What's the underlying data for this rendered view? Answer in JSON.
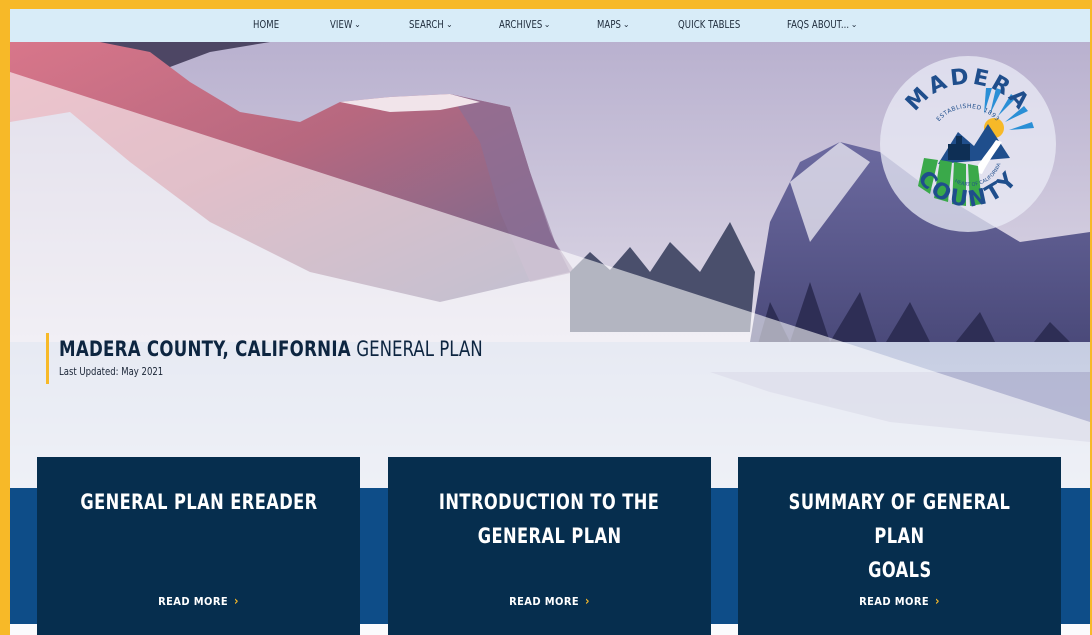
{
  "nav": {
    "items": [
      {
        "label": "HOME",
        "dropdown": false
      },
      {
        "label": "VIEW",
        "dropdown": true
      },
      {
        "label": "SEARCH",
        "dropdown": true
      },
      {
        "label": "ARCHIVES",
        "dropdown": true
      },
      {
        "label": "MAPS",
        "dropdown": true
      },
      {
        "label": "QUICK TABLES",
        "dropdown": false
      },
      {
        "label": "FAQS ABOUT...",
        "dropdown": true
      }
    ],
    "chevron": "⌄"
  },
  "seal": {
    "top_text": "MADERA",
    "bottom_text": "COUNTY",
    "established": "ESTABLISHED 1893",
    "motto": "HEART OF CALIFORNIA"
  },
  "hero": {
    "title_bold": "MADERA COUNTY, CALIFORNIA",
    "title_light": "GENERAL PLAN",
    "updated": "Last Updated: May 2021"
  },
  "cards": [
    {
      "title_lines": [
        "GENERAL PLAN EREADER"
      ],
      "link": "READ MORE",
      "arrow": "›"
    },
    {
      "title_lines": [
        "INTRODUCTION TO THE",
        "GENERAL PLAN"
      ],
      "link": "READ MORE",
      "arrow": "›"
    },
    {
      "title_lines": [
        "SUMMARY OF GENERAL PLAN",
        "GOALS"
      ],
      "link": "READ MORE",
      "arrow": "›"
    }
  ],
  "colors": {
    "accent": "#f7b928",
    "nav_bg": "#d8ecf8",
    "band": "#0e4d88",
    "card": "#062e4e"
  }
}
